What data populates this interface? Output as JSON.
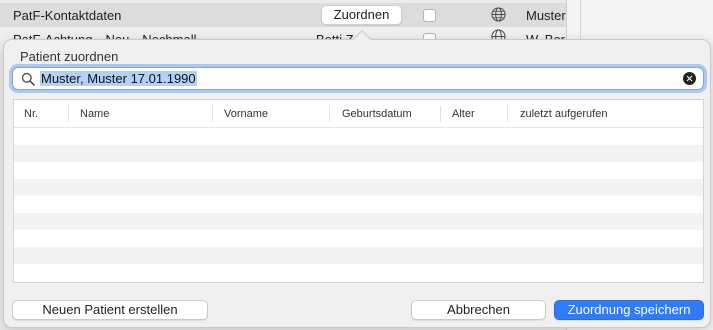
{
  "background": {
    "rows": [
      {
        "label": "PatF-Kontaktdaten",
        "button": "Zuordnen",
        "muster": "Muster"
      },
      {
        "label": "PatF-Achtung---Neu---Nochmall",
        "col2": "Betti  Zen",
        "muster": "W. Ber"
      }
    ]
  },
  "dialog": {
    "title": "Patient zuordnen",
    "search": {
      "value": "Muster, Muster 17.01.1990"
    },
    "columns": [
      "Nr.",
      "Name",
      "Vorname",
      "Geburtsdatum",
      "Alter",
      "zuletzt aufgerufen"
    ],
    "buttons": {
      "new_patient": "Neuen Patient erstellen",
      "cancel": "Abbrechen",
      "save": "Zuordnung speichern"
    }
  },
  "colors": {
    "accent": "#2f7cf6",
    "selection": "#b4d0f5"
  },
  "icons": [
    "search-icon",
    "clear-icon",
    "globe-icon"
  ]
}
